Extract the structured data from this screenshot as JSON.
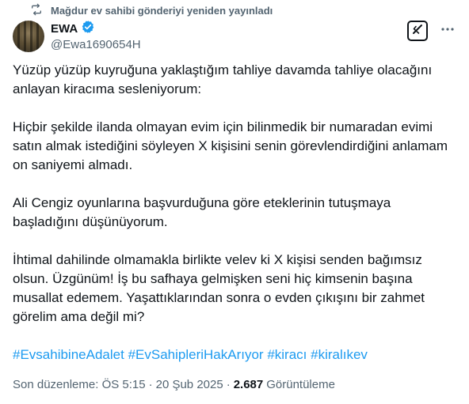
{
  "repost": {
    "text": "Mağdur ev sahibi gönderiyi yeniden yayınladı",
    "icon": "repost-icon"
  },
  "author": {
    "display_name": "EWA",
    "handle": "@Ewa1690654H",
    "verified_color": "#1d9bf0"
  },
  "actions": {
    "grok_icon": "grok-icon",
    "more_icon": "more-horizontal-icon"
  },
  "tweet": {
    "paragraphs": [
      "Yüzüp yüzüp kuyruğuna yaklaştığım tahliye davamda tahliye olacağını anlayan kiracıma sesleniyorum:",
      "Hiçbir şekilde ilanda olmayan evim için bilinmedik bir numaradan evimi satın almak istediğini söyleyen X kişisini senin görevlendirdiğini anlamam on saniyemi almadı.",
      "Ali Cengiz oyunlarına başvurduğuna göre eteklerinin tutuşmaya başladığını düşünüyorum.",
      "İhtimal dahilinde olmamakla birlikte velev ki X kişisi senden bağımsız olsun. Üzgünüm! İş bu safhaya gelmişken seni hiç kimsenin başına musallat edemem. Yaşattıklarından sonra o evden çıkışını bir zahmet görelim ama değil mi?"
    ],
    "hashtags": [
      "#EvsahibineAdalet",
      "#EvSahipleriHakArıyor",
      "#kiracı",
      "#kiralıkev"
    ]
  },
  "meta": {
    "edited_label": "Son düzenleme: ÖS 5:15",
    "separator": "·",
    "date": "20 Şub 2025",
    "views_count": "2.687",
    "views_label": "Görüntüleme"
  },
  "colors": {
    "link": "#1d9bf0",
    "secondary_text": "#536471",
    "primary_text": "#0f1419"
  }
}
